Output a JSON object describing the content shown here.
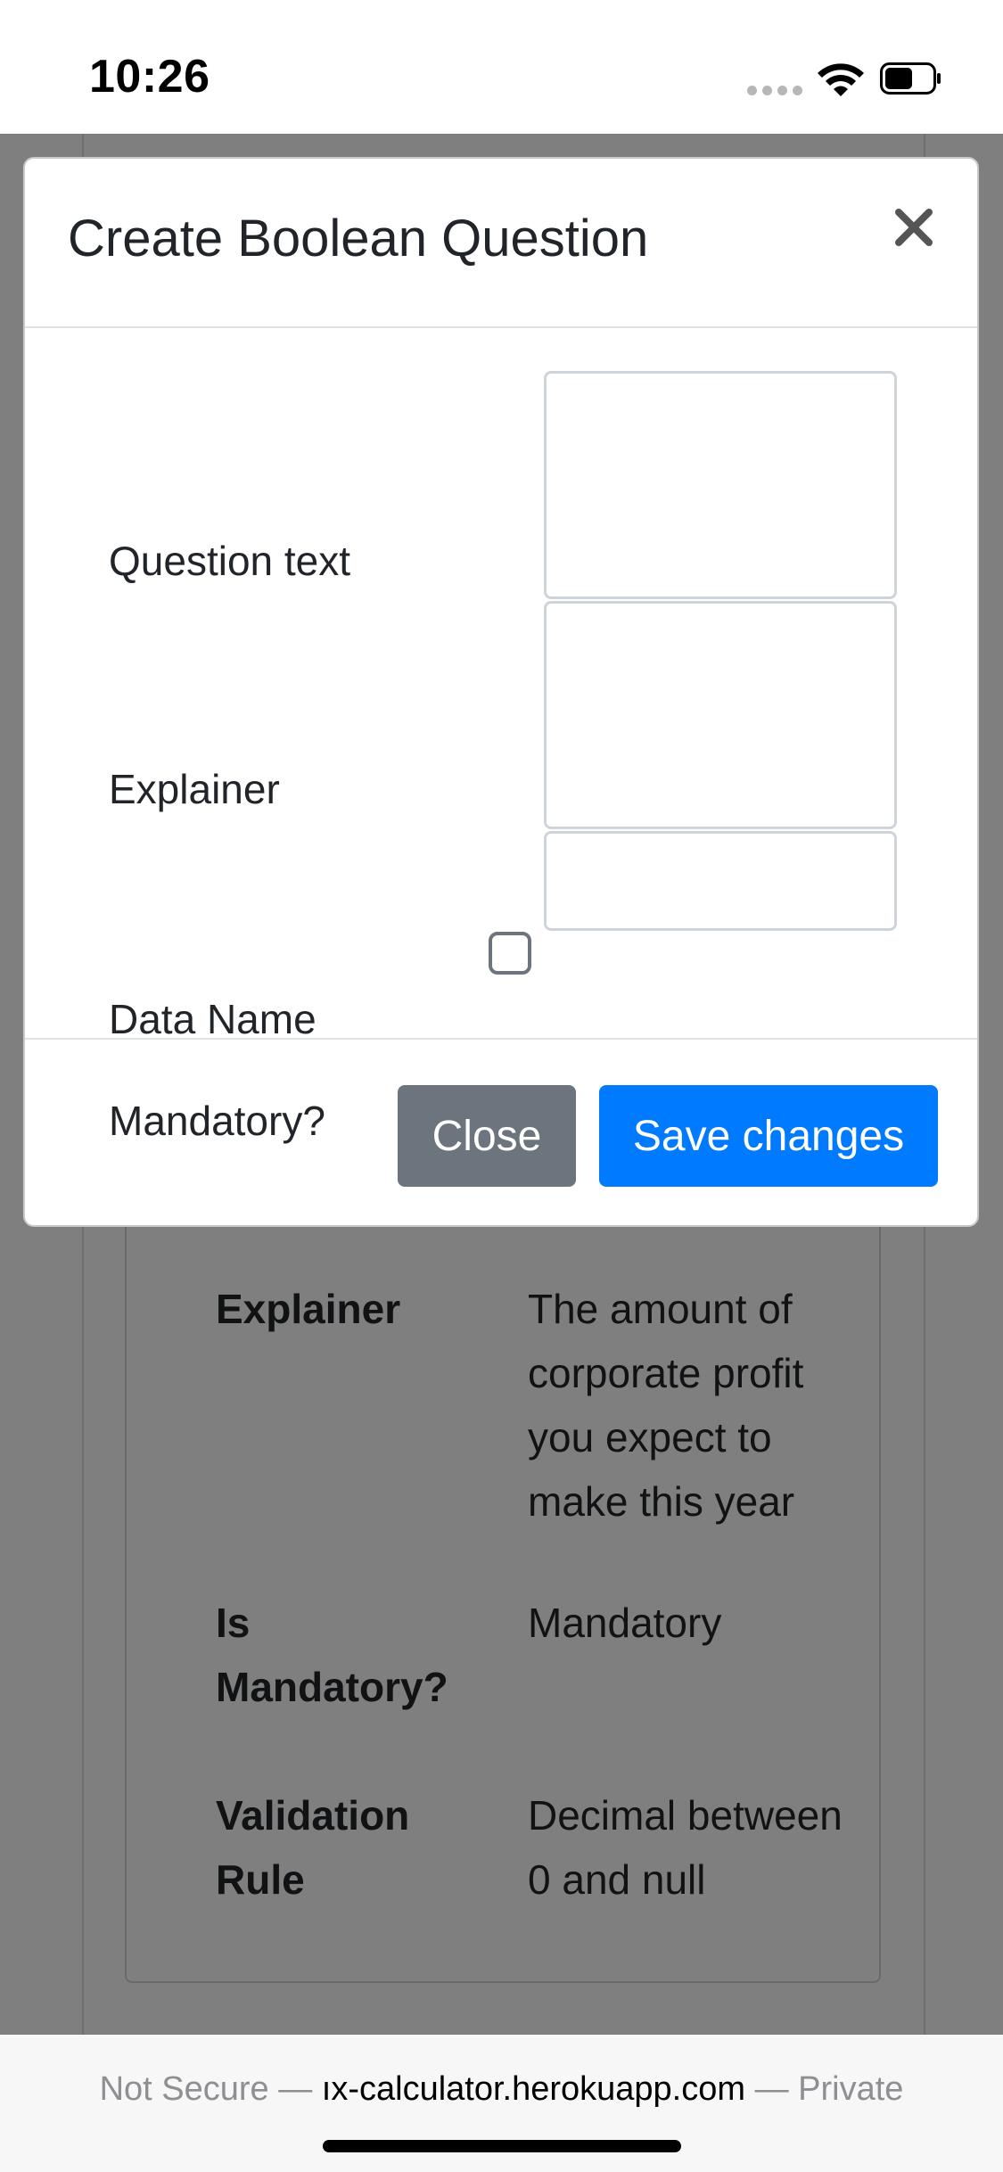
{
  "status_bar": {
    "time": "10:26",
    "icons": [
      "signal-dots-icon",
      "wifi-icon",
      "battery-icon"
    ]
  },
  "modal": {
    "title": "Create Boolean Question",
    "close_icon": "close-icon",
    "fields": {
      "question_text_label": "Question text",
      "explainer_label": "Explainer",
      "data_name_label": "Data Name",
      "mandatory_label": "Mandatory?",
      "question_text_value": "",
      "explainer_value": "",
      "data_name_value": "",
      "mandatory_checked": false
    },
    "buttons": {
      "close_label": "Close",
      "save_label": "Save changes"
    },
    "colors": {
      "close_button": "#6c757d",
      "save_button": "#007bff"
    }
  },
  "background_details": {
    "rows": [
      {
        "label": "Explainer",
        "value": "The amount of corporate profit you expect to make this year"
      },
      {
        "label": "Is Mandatory?",
        "value": "Mandatory"
      },
      {
        "label": "Validation Rule",
        "value": "Decimal between 0 and null"
      }
    ]
  },
  "url_bar": {
    "prefix": "Not Secure — ",
    "host": "ıx-calculator.herokuapp.com",
    "suffix": " — Private"
  }
}
